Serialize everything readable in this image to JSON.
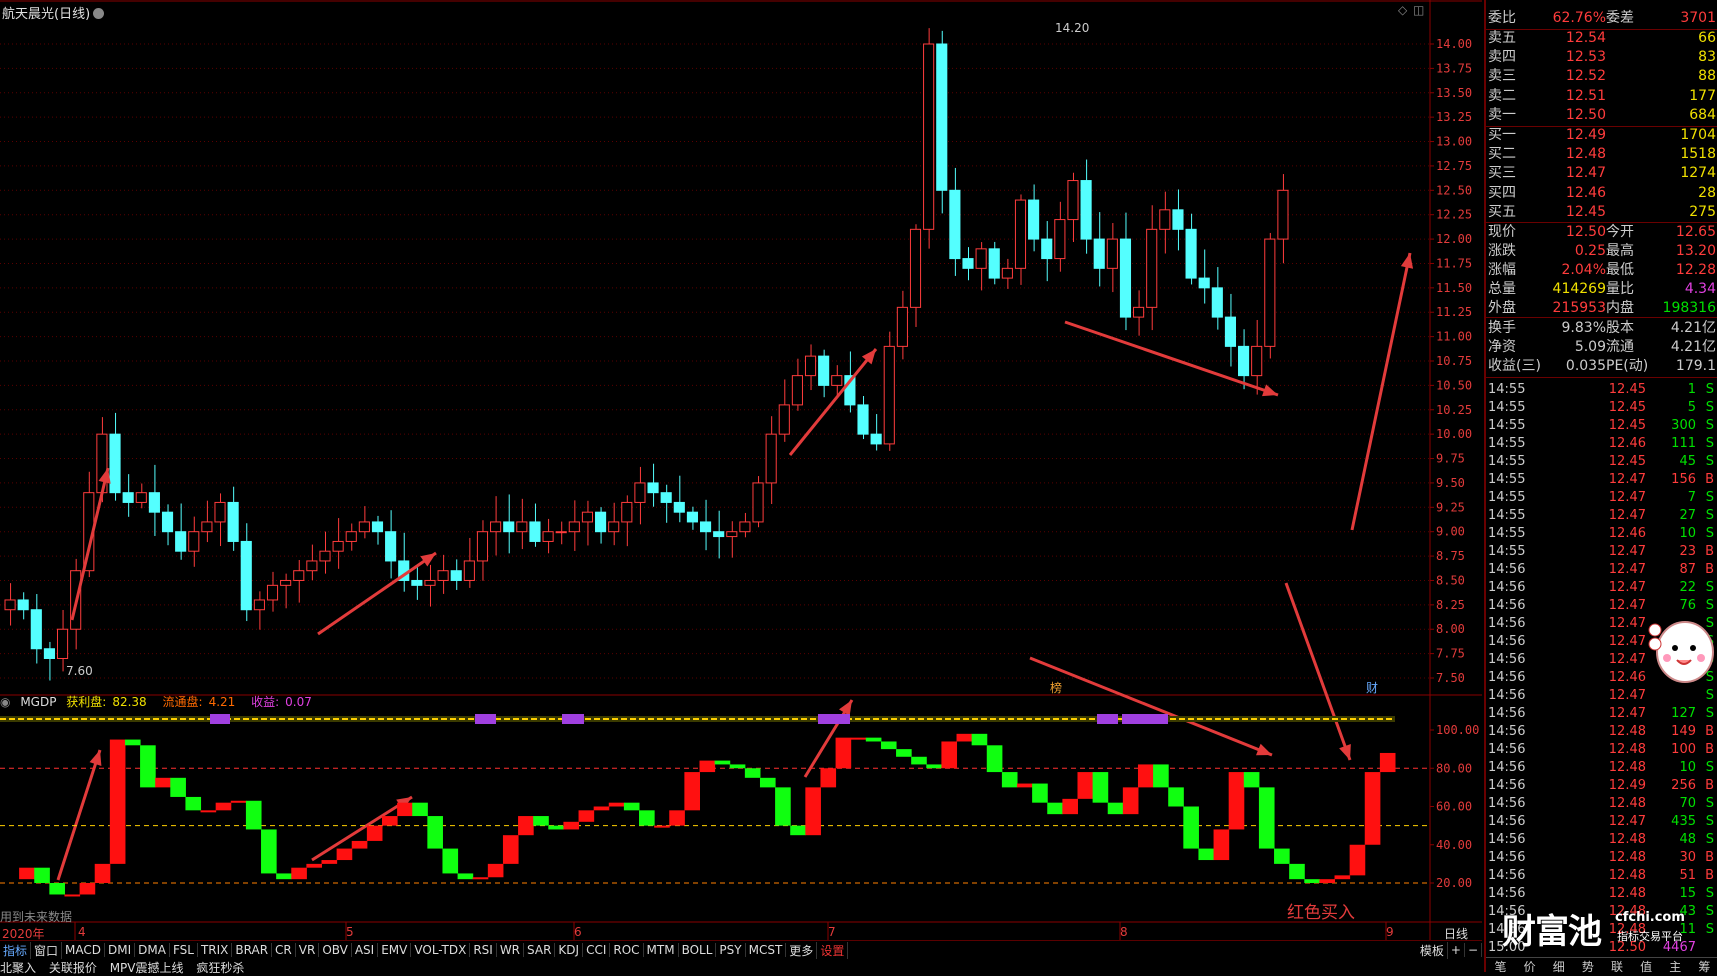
{
  "window": {
    "title": "航天晨光(日线)"
  },
  "main_chart": {
    "price_axis": [
      "14.00",
      "13.75",
      "13.50",
      "13.25",
      "13.00",
      "12.75",
      "12.50",
      "12.25",
      "12.00",
      "11.75",
      "11.50",
      "11.25",
      "11.00",
      "10.75",
      "10.50",
      "10.25",
      "10.00",
      "9.75",
      "9.50",
      "9.25",
      "9.00",
      "8.75",
      "8.50",
      "8.25",
      "8.00",
      "7.75",
      "7.50"
    ],
    "high_label": "14.20",
    "low_label": "7.60",
    "markers": [
      "榜",
      "财"
    ]
  },
  "indicator": {
    "name": "MGDP",
    "profit_label": "获利盘:",
    "profit_value": "82.38",
    "float_label": "流通盘:",
    "float_value": "4.21",
    "earn_label": "收益:",
    "earn_value": "0.07",
    "axis": [
      "100.00",
      "80.00",
      "60.00",
      "40.00",
      "20.00"
    ],
    "future_note": "用到未来数据",
    "buy_note": "红色买入"
  },
  "x_axis": {
    "year": "2020年",
    "months": [
      "4",
      "5",
      "6",
      "7",
      "8",
      "9"
    ],
    "period": "日线"
  },
  "tabs": [
    "指标",
    "窗口",
    "MACD",
    "DMI",
    "DMA",
    "FSL",
    "TRIX",
    "BRAR",
    "CR",
    "VR",
    "OBV",
    "ASI",
    "EMV",
    "VOL-TDX",
    "RSI",
    "WR",
    "SAR",
    "KDJ",
    "CCI",
    "ROC",
    "MTM",
    "BOLL",
    "PSY",
    "MCST",
    "更多",
    "设置"
  ],
  "tabs_right": [
    "模板",
    "+",
    "−"
  ],
  "subbar": [
    "北聚入",
    "关联报价",
    "MPV震撼上线",
    "疯狂秒杀"
  ],
  "quote": {
    "weibi_label": "委比",
    "weibi": "62.76%",
    "weicha_label": "委差",
    "weicha": "3701",
    "asks": [
      {
        "label": "卖五",
        "price": "12.54",
        "vol": "66"
      },
      {
        "label": "卖四",
        "price": "12.53",
        "vol": "83"
      },
      {
        "label": "卖三",
        "price": "12.52",
        "vol": "88"
      },
      {
        "label": "卖二",
        "price": "12.51",
        "vol": "177"
      },
      {
        "label": "卖一",
        "price": "12.50",
        "vol": "684"
      }
    ],
    "bids": [
      {
        "label": "买一",
        "price": "12.49",
        "vol": "1704"
      },
      {
        "label": "买二",
        "price": "12.48",
        "vol": "1518"
      },
      {
        "label": "买三",
        "price": "12.47",
        "vol": "1274"
      },
      {
        "label": "买四",
        "price": "12.46",
        "vol": "28"
      },
      {
        "label": "买五",
        "price": "12.45",
        "vol": "275"
      }
    ],
    "stats": [
      {
        "l1": "现价",
        "v1": "12.50",
        "c1": "red",
        "l2": "今开",
        "v2": "12.65",
        "c2": "red"
      },
      {
        "l1": "涨跌",
        "v1": "0.25",
        "c1": "red",
        "l2": "最高",
        "v2": "13.20",
        "c2": "red"
      },
      {
        "l1": "涨幅",
        "v1": "2.04%",
        "c1": "red",
        "l2": "最低",
        "v2": "12.28",
        "c2": "red"
      },
      {
        "l1": "总量",
        "v1": "414269",
        "c1": "yel",
        "l2": "量比",
        "v2": "4.34",
        "c2": "mag"
      },
      {
        "l1": "外盘",
        "v1": "215953",
        "c1": "red",
        "l2": "内盘",
        "v2": "198316",
        "c2": "grn"
      }
    ],
    "stats2": [
      {
        "l1": "换手",
        "v1": "9.83%",
        "l2": "股本",
        "v2": "4.21亿"
      },
      {
        "l1": "净资",
        "v1": "5.09",
        "l2": "流通",
        "v2": "4.21亿"
      },
      {
        "l1": "收益(三)",
        "v1": "0.035",
        "l2": "PE(动)",
        "v2": "179.1"
      }
    ],
    "ticks": [
      {
        "t": "14:55",
        "p": "12.45",
        "q": "1",
        "s": "S"
      },
      {
        "t": "14:55",
        "p": "12.45",
        "q": "5",
        "s": "S"
      },
      {
        "t": "14:55",
        "p": "12.45",
        "q": "300",
        "s": "S"
      },
      {
        "t": "14:55",
        "p": "12.46",
        "q": "111",
        "s": "S"
      },
      {
        "t": "14:55",
        "p": "12.45",
        "q": "45",
        "s": "S"
      },
      {
        "t": "14:55",
        "p": "12.47",
        "q": "156",
        "s": "B"
      },
      {
        "t": "14:55",
        "p": "12.47",
        "q": "7",
        "s": "S"
      },
      {
        "t": "14:55",
        "p": "12.47",
        "q": "27",
        "s": "S"
      },
      {
        "t": "14:55",
        "p": "12.46",
        "q": "10",
        "s": "S"
      },
      {
        "t": "14:55",
        "p": "12.47",
        "q": "23",
        "s": "B"
      },
      {
        "t": "14:56",
        "p": "12.47",
        "q": "87",
        "s": "B"
      },
      {
        "t": "14:56",
        "p": "12.47",
        "q": "22",
        "s": "S"
      },
      {
        "t": "14:56",
        "p": "12.47",
        "q": "76",
        "s": "S"
      },
      {
        "t": "14:56",
        "p": "12.47",
        "q": "",
        "s": "S"
      },
      {
        "t": "14:56",
        "p": "12.47",
        "q": "",
        "s": "S"
      },
      {
        "t": "14:56",
        "p": "12.47",
        "q": "",
        "s": "S"
      },
      {
        "t": "14:56",
        "p": "12.46",
        "q": "",
        "s": "S"
      },
      {
        "t": "14:56",
        "p": "12.47",
        "q": "",
        "s": "S"
      },
      {
        "t": "14:56",
        "p": "12.47",
        "q": "127",
        "s": "S"
      },
      {
        "t": "14:56",
        "p": "12.48",
        "q": "149",
        "s": "B"
      },
      {
        "t": "14:56",
        "p": "12.48",
        "q": "100",
        "s": "B"
      },
      {
        "t": "14:56",
        "p": "12.48",
        "q": "10",
        "s": "S"
      },
      {
        "t": "14:56",
        "p": "12.49",
        "q": "256",
        "s": "B"
      },
      {
        "t": "14:56",
        "p": "12.48",
        "q": "70",
        "s": "S"
      },
      {
        "t": "14:56",
        "p": "12.47",
        "q": "435",
        "s": "S"
      },
      {
        "t": "14:56",
        "p": "12.48",
        "q": "48",
        "s": "S"
      },
      {
        "t": "14:56",
        "p": "12.48",
        "q": "30",
        "s": "B"
      },
      {
        "t": "14:56",
        "p": "12.48",
        "q": "51",
        "s": "B"
      },
      {
        "t": "14:56",
        "p": "12.48",
        "q": "15",
        "s": "S"
      },
      {
        "t": "14:56",
        "p": "12.48",
        "q": "43",
        "s": "S"
      },
      {
        "t": "14:56",
        "p": "12.48",
        "q": "11",
        "s": "S"
      },
      {
        "t": "15:00",
        "p": "12.50",
        "q": "4467",
        "s": ""
      }
    ],
    "side_tabs": [
      "笔",
      "价",
      "细",
      "势",
      "联",
      "值",
      "主",
      "筹"
    ]
  },
  "branding": {
    "logo": "财富池",
    "site": "cfchi.com",
    "slogan": "指标交易平台"
  }
}
